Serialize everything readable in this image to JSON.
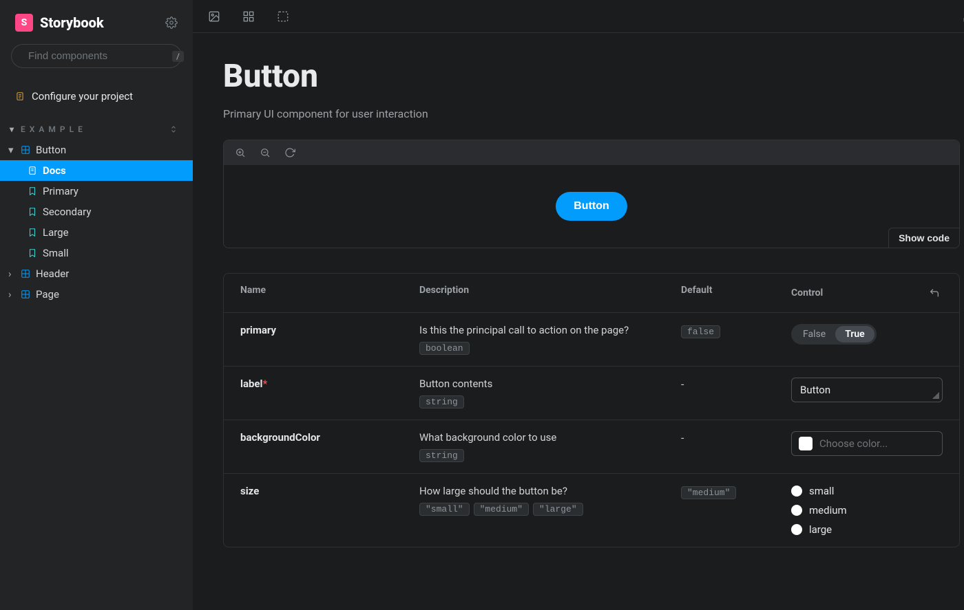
{
  "brand": {
    "logo_letter": "S",
    "name": "Storybook"
  },
  "search": {
    "placeholder": "Find components",
    "shortcut": "/"
  },
  "configure_label": "Configure your project",
  "group_label": "EXAMPLE",
  "tree": {
    "button": {
      "label": "Button",
      "children": {
        "docs": "Docs",
        "primary": "Primary",
        "secondary": "Secondary",
        "large": "Large",
        "small": "Small"
      }
    },
    "header": {
      "label": "Header"
    },
    "page": {
      "label": "Page"
    }
  },
  "docs": {
    "title": "Button",
    "subtitle": "Primary UI component for user interaction",
    "preview_button_label": "Button",
    "show_code_label": "Show code",
    "args_header": {
      "name": "Name",
      "description": "Description",
      "default": "Default",
      "control": "Control"
    },
    "rows": [
      {
        "name": "primary",
        "required": false,
        "description": "Is this the principal call to action on the page?",
        "types": [
          "boolean"
        ],
        "default_code": "false",
        "default_text": null,
        "control": {
          "kind": "toggle",
          "off_label": "False",
          "on_label": "True",
          "value": true
        }
      },
      {
        "name": "label",
        "required": true,
        "description": "Button contents",
        "types": [
          "string"
        ],
        "default_code": null,
        "default_text": "-",
        "control": {
          "kind": "text",
          "value": "Button"
        }
      },
      {
        "name": "backgroundColor",
        "required": false,
        "description": "What background color to use",
        "types": [
          "string"
        ],
        "default_code": null,
        "default_text": "-",
        "control": {
          "kind": "color",
          "placeholder": "Choose color..."
        }
      },
      {
        "name": "size",
        "required": false,
        "description": "How large should the button be?",
        "types": [
          "\"small\"",
          "\"medium\"",
          "\"large\""
        ],
        "default_code": "\"medium\"",
        "default_text": null,
        "control": {
          "kind": "radio",
          "options": [
            "small",
            "medium",
            "large"
          ],
          "value": null
        }
      }
    ]
  }
}
